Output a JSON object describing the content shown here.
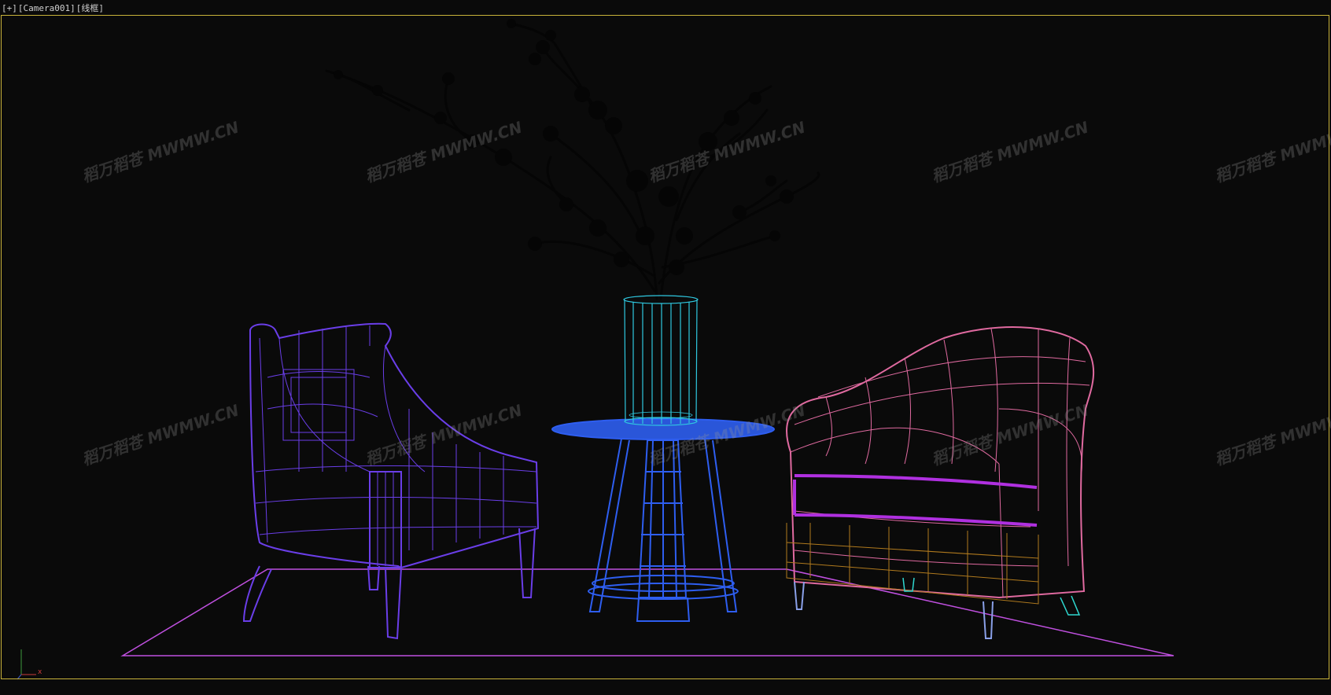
{
  "viewport": {
    "menu_plus": "[+]",
    "menu_camera": "[Camera001]",
    "menu_shading": "[线框]"
  },
  "axis": {
    "x_label": "x"
  },
  "watermark": {
    "text": "MWMW.CN",
    "logo_text": "稻万稻苍"
  },
  "colors": {
    "frame": "#c8b23a",
    "chair_left": "#6a3ee8",
    "chair_right": "#e06aa0",
    "table": "#2e5ef0",
    "vase": "#2fc8e0",
    "rug": "#c050e0",
    "cushion": "#b030e0",
    "base": "#b07a1e"
  }
}
